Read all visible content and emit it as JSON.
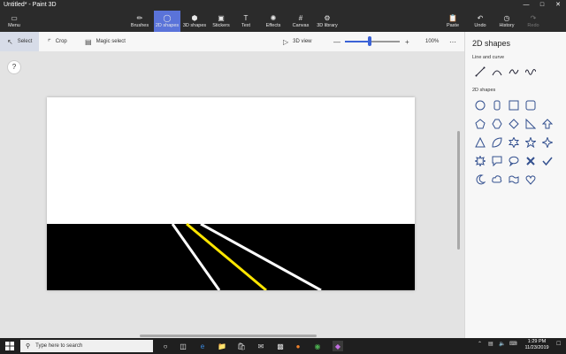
{
  "titlebar": {
    "title": "Untitled* - Paint 3D"
  },
  "toolbar": {
    "menu": "Menu",
    "brushes": "Brushes",
    "shapes2d": "2D shapes",
    "shapes3d": "3D shapes",
    "stickers": "Stickers",
    "text": "Text",
    "effects": "Effects",
    "canvas": "Canvas",
    "library3d": "3D library",
    "paste": "Paste",
    "undo": "Undo",
    "history": "History",
    "redo": "Redo"
  },
  "subbar": {
    "select": "Select",
    "crop": "Crop",
    "magic_select": "Magic select",
    "view3d": "3D view",
    "zoom": "100%",
    "zoom_level": 0.45
  },
  "panel": {
    "title": "2D shapes",
    "line_section": "Line and curve",
    "shapes_section": "2D shapes"
  },
  "taskbar": {
    "search_placeholder": "Type here to search",
    "time": "1:29 PM",
    "date": "11/23/2019"
  },
  "colors": {
    "accent": "#5a73d9",
    "road": "#000000",
    "lane_white": "#ffffff",
    "lane_yellow": "#ffe600"
  }
}
